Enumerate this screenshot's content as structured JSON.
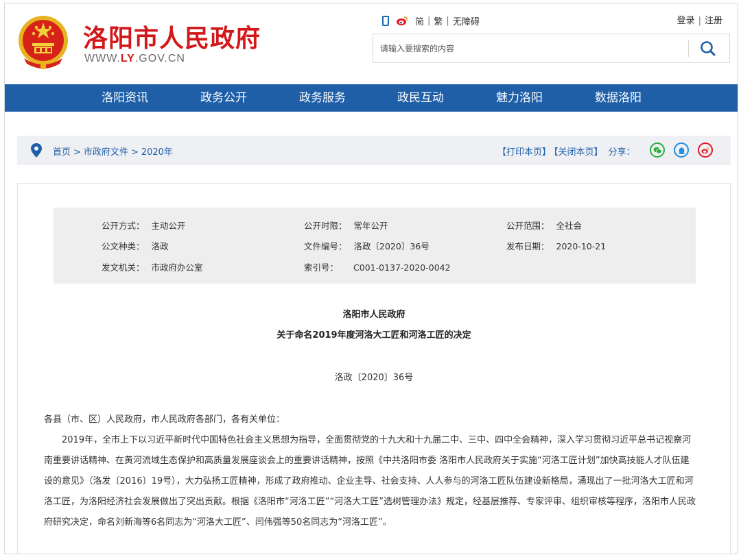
{
  "header": {
    "site_name": "洛阳市人民政府",
    "url_prefix": "WWW.",
    "url_ly": "LY",
    "url_suffix": ".GOV.CN",
    "lang_simplified": "简",
    "lang_traditional": "繁",
    "accessibility": "无障碍",
    "login": "登录",
    "register": "注册",
    "search_placeholder": "请输入要搜索的内容",
    "accent_color": "#d3181b",
    "nav_color": "#1e5fa8"
  },
  "nav": [
    {
      "label": "洛阳资讯"
    },
    {
      "label": "政务公开"
    },
    {
      "label": "政务服务"
    },
    {
      "label": "政民互动"
    },
    {
      "label": "魅力洛阳"
    },
    {
      "label": "数据洛阳"
    }
  ],
  "breadcrumb": {
    "home": "首页",
    "level2": "市政府文件",
    "level3": "2020年",
    "separator": ">",
    "print": "【打印本页】",
    "close": "【关闭本页】",
    "share": "分享："
  },
  "meta": {
    "open_method_k": "公开方式：",
    "open_method_v": "主动公开",
    "open_period_k": "公开时限：",
    "open_period_v": "常年公开",
    "open_scope_k": "公开范围：",
    "open_scope_v": "全社会",
    "doc_type_k": "公文种类：",
    "doc_type_v": "洛政",
    "file_no_k": "文件编号：",
    "file_no_v": "洛政〔2020〕36号",
    "pub_date_k": "发布日期：",
    "pub_date_v": "2020-10-21",
    "issuer_k": "发文机关：",
    "issuer_v": "市政府办公室",
    "index_k": "索引号：",
    "index_v": "C001-0137-2020-0042"
  },
  "doc": {
    "title1": "洛阳市人民政府",
    "title2": "关于命名2019年度河洛大工匠和河洛工匠的决定",
    "number": "洛政〔2020〕36号",
    "salutation": "各县（市、区）人民政府，市人民政府各部门，各有关单位：",
    "paragraph1": "2019年，全市上下以习近平新时代中国特色社会主义思想为指导，全面贯彻党的十九大和十九届二中、三中、四中全会精神，深入学习贯彻习近平总书记视察河南重要讲话精神、在黄河流域生态保护和高质量发展座谈会上的重要讲话精神，按照《中共洛阳市委 洛阳市人民政府关于实施“河洛工匠计划”加快高技能人才队伍建设的意见》（洛发〔2016〕19号），大力弘扬工匠精神，形成了政府推动、企业主导、社会支持、人人参与的河洛工匠队伍建设新格局，涌现出了一批河洛大工匠和河洛工匠，为洛阳经济社会发展做出了突出贡献。根据《洛阳市“河洛工匠”“河洛大工匠”选树管理办法》规定，经基层推荐、专家评审、组织审核等程序，洛阳市人民政府研究决定，命名刘新海等6名同志为“河洛大工匠”、闫伟强等50名同志为“河洛工匠”。"
  }
}
